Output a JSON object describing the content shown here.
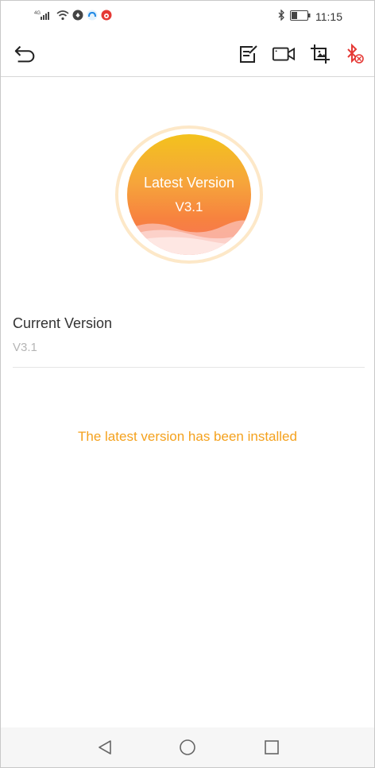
{
  "status_bar": {
    "network_label": "4G",
    "time": "11:15",
    "icons": [
      "signal-icon",
      "wifi-icon",
      "shield-app-icon",
      "cloud-app-icon",
      "weibo-app-icon",
      "bluetooth-icon",
      "battery-icon"
    ]
  },
  "toolbar": {
    "icons": [
      "back-arrow-icon",
      "edit-note-icon",
      "video-camera-icon",
      "image-crop-icon",
      "bluetooth-disconnected-icon"
    ],
    "accent_color": "#e53935"
  },
  "badge": {
    "title": "Latest Version",
    "version": "V3.1",
    "gradient": [
      "#f3c21d",
      "#f8715a"
    ]
  },
  "current": {
    "label": "Current Version",
    "value": "V3.1"
  },
  "message": {
    "text": "The latest version has been installed",
    "color": "#f4a11d"
  },
  "nav": {
    "icons": [
      "nav-back-icon",
      "nav-home-icon",
      "nav-recents-icon"
    ]
  }
}
